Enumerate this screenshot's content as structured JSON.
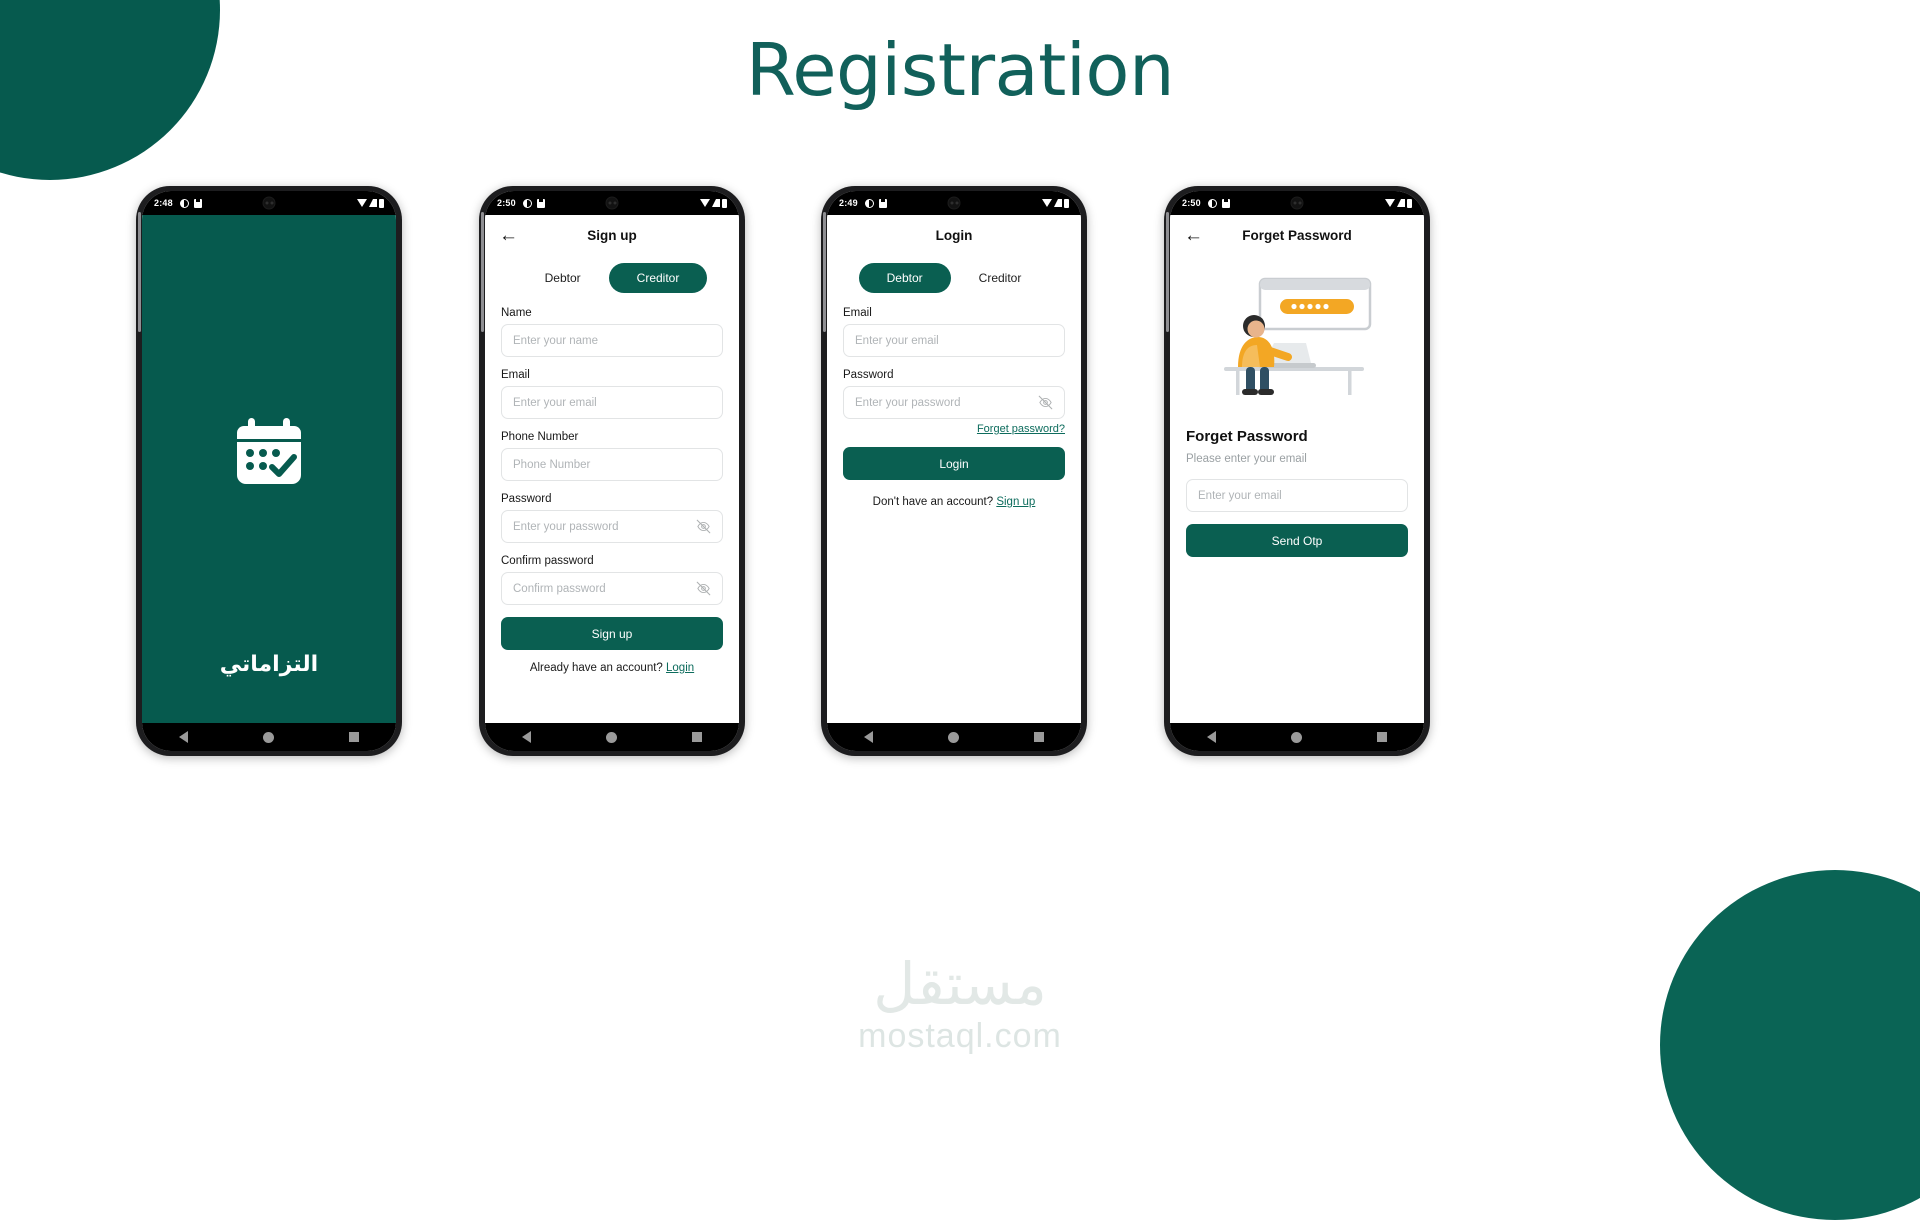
{
  "page": {
    "title": "Registration",
    "title_color": "#11605A",
    "brand_teal": "#065A4E",
    "accent_teal": "#0A5F51",
    "link_teal": "#0d6c5d"
  },
  "watermark": {
    "arabic": "مستقل",
    "latin": "mostaql.com"
  },
  "phones": [
    {
      "id": "splash",
      "status_bar": {
        "time": "2:48",
        "left_icons": [
          "clock-icon",
          "save-icon"
        ],
        "right_icons": [
          "wifi-icon",
          "signal-icon",
          "battery-icon"
        ]
      },
      "screen": {
        "kind": "splash",
        "logo_icon": "calendar-check-icon",
        "app_name_arabic": "التزاماتي"
      },
      "nav_bar": [
        "back-triangle-icon",
        "home-circle-icon",
        "recents-square-icon"
      ]
    },
    {
      "id": "signup",
      "status_bar": {
        "time": "2:50",
        "left_icons": [
          "clock-icon",
          "save-icon"
        ],
        "right_icons": [
          "wifi-icon",
          "signal-icon",
          "battery-icon"
        ]
      },
      "screen": {
        "kind": "form",
        "appbar": {
          "back_icon": "arrow-left-icon",
          "title": "Sign up",
          "has_back": true
        },
        "role_toggle": {
          "options": [
            "Debtor",
            "Creditor"
          ],
          "selected": "Creditor"
        },
        "fields": [
          {
            "label": "Name",
            "placeholder": "Enter your name",
            "value": "",
            "password": false
          },
          {
            "label": "Email",
            "placeholder": "Enter your email",
            "value": "",
            "password": false
          },
          {
            "label": "Phone Number",
            "placeholder": "Phone Number",
            "value": "",
            "password": false
          },
          {
            "label": "Password",
            "placeholder": "Enter your password",
            "value": "",
            "password": true
          },
          {
            "label": "Confirm password",
            "placeholder": "Confirm password",
            "value": "",
            "password": true
          }
        ],
        "primary_button": "Sign up",
        "bottom_note_text": "Already have an account? ",
        "bottom_note_link": "Login"
      },
      "nav_bar": [
        "back-triangle-icon",
        "home-circle-icon",
        "recents-square-icon"
      ]
    },
    {
      "id": "login",
      "status_bar": {
        "time": "2:49",
        "left_icons": [
          "clock-icon",
          "save-icon"
        ],
        "right_icons": [
          "wifi-icon",
          "signal-icon",
          "battery-icon"
        ]
      },
      "screen": {
        "kind": "form",
        "appbar": {
          "back_icon": "",
          "title": "Login",
          "has_back": false
        },
        "role_toggle": {
          "options": [
            "Debtor",
            "Creditor"
          ],
          "selected": "Debtor"
        },
        "fields": [
          {
            "label": "Email",
            "placeholder": "Enter your email",
            "value": "",
            "password": false
          },
          {
            "label": "Password",
            "placeholder": "Enter your password",
            "value": "",
            "password": true
          }
        ],
        "forget_link": "Forget password?",
        "primary_button": "Login",
        "bottom_note_text": "Don't have an account? ",
        "bottom_note_link": "Sign up"
      },
      "nav_bar": [
        "back-triangle-icon",
        "home-circle-icon",
        "recents-square-icon"
      ]
    },
    {
      "id": "forget-password",
      "status_bar": {
        "time": "2:50",
        "left_icons": [
          "clock-icon",
          "save-icon"
        ],
        "right_icons": [
          "wifi-icon",
          "signal-icon",
          "battery-icon"
        ]
      },
      "screen": {
        "kind": "forget",
        "appbar": {
          "back_icon": "arrow-left-icon",
          "title": "Forget Password",
          "has_back": true
        },
        "illustration": "person-at-desk-password-icon",
        "heading": "Forget Password",
        "subtext": "Please enter your email",
        "field": {
          "label": "",
          "placeholder": "Enter your email",
          "value": ""
        },
        "primary_button": "Send Otp"
      },
      "nav_bar": [
        "back-triangle-icon",
        "home-circle-icon",
        "recents-square-icon"
      ]
    }
  ]
}
